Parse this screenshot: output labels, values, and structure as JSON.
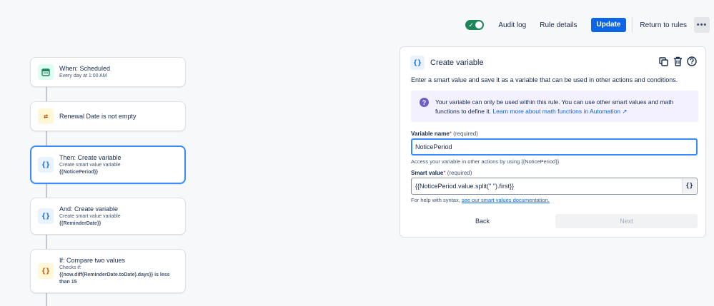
{
  "topbar": {
    "toggle_icon": "check-icon",
    "audit_log": "Audit log",
    "rule_details": "Rule details",
    "update": "Update",
    "return_to_rules": "Return to rules",
    "more": "•••"
  },
  "flow": [
    {
      "icon": "{ }",
      "title": "When: Scheduled",
      "sub": "Every day at 1:00 AM"
    },
    {
      "icon": "⇄",
      "title": "Renewal Date is not empty"
    },
    {
      "icon": "{}",
      "title": "Then: Create variable",
      "sub": "Create smart value variable",
      "bold": "{{NoticePeriod}}"
    },
    {
      "icon": "{}",
      "title": "And: Create variable",
      "sub": "Create smart value variable",
      "bold": "{{ReminderDate}}"
    },
    {
      "icon": "{}",
      "title": "If: Compare two values",
      "sub": "Checks if:",
      "bold": "{{now.diff(ReminderDate.toDate).days}} is less than 15"
    }
  ],
  "panel": {
    "icon": "{}",
    "title": "Create variable",
    "description": "Enter a smart value and save it as a variable that can be used in other actions and conditions.",
    "info_icon": "?",
    "info_text": "Your variable can only be used within this rule. You can use other smart values and math functions to define it.",
    "info_link": "Learn more about math functions in Automation ↗",
    "var_name_label": "Variable name",
    "required_star": "*",
    "required_text": "(required)",
    "var_name_value": "NoticePeriod",
    "var_name_help": "Access your variable in other actions by using {{NoticePeriod}}",
    "smart_value_label": "Smart value",
    "smart_value_value": "{{NoticePeriod.value.split(\" \").first}}",
    "smart_btn": "{}",
    "smart_help_prefix": "For help with syntax,",
    "smart_help_link": "see our smart values documentation.",
    "back": "Back",
    "next": "Next"
  },
  "colors": {
    "primary": "#0c66e4",
    "toggle_on": "#1f845a",
    "selected_border": "#388bff",
    "info_bg": "#f3f0ff"
  }
}
